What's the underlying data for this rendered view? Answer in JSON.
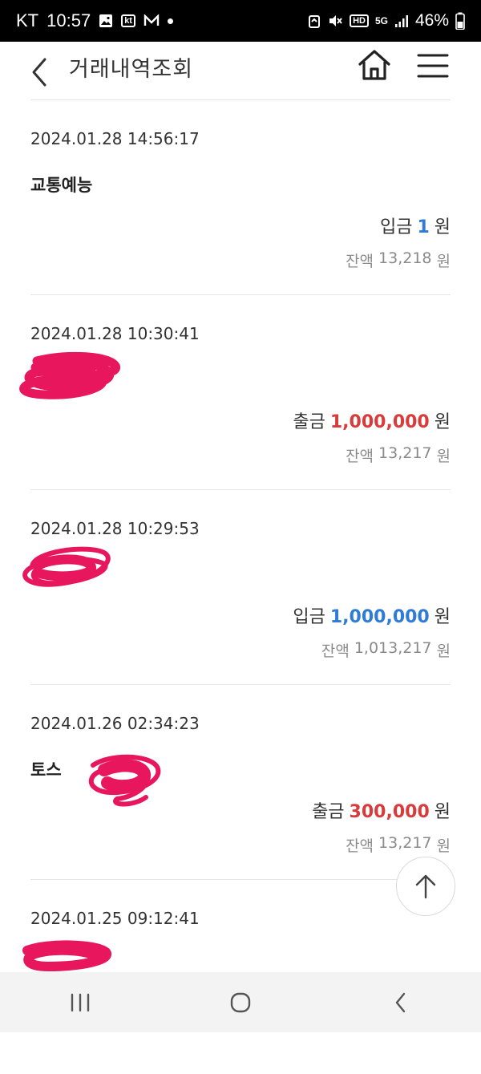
{
  "status_bar": {
    "carrier": "KT",
    "time": "10:57",
    "kt_badge": "kt",
    "network": "5G",
    "hd_badge": "HD",
    "battery": "46%"
  },
  "header": {
    "title": "거래내역조회",
    "icons": [
      "back-icon",
      "home-icon",
      "menu-icon"
    ]
  },
  "transactions": [
    {
      "datetime": "2024.01.28 14:56:17",
      "description": "교통예능",
      "type_label": "입금",
      "type": "deposit",
      "amount": "1",
      "currency": "원",
      "balance_label": "잔액",
      "balance": "13,218",
      "balance_currency": "원"
    },
    {
      "datetime": "2024.01.28 10:30:41",
      "description": "",
      "type_label": "출금",
      "type": "withdraw",
      "amount": "1,000,000",
      "currency": "원",
      "balance_label": "잔액",
      "balance": "13,217",
      "balance_currency": "원"
    },
    {
      "datetime": "2024.01.28 10:29:53",
      "description": "",
      "type_label": "입금",
      "type": "deposit",
      "amount": "1,000,000",
      "currency": "원",
      "balance_label": "잔액",
      "balance": "1,013,217",
      "balance_currency": "원"
    },
    {
      "datetime": "2024.01.26 02:34:23",
      "description": "토스",
      "type_label": "출금",
      "type": "withdraw",
      "amount": "300,000",
      "currency": "원",
      "balance_label": "잔액",
      "balance": "13,217",
      "balance_currency": "원"
    },
    {
      "datetime": "2024.01.25 09:12:41",
      "description": "",
      "type_label": "",
      "type": "",
      "amount": "",
      "currency": "",
      "balance_label": "",
      "balance": "",
      "balance_currency": ""
    }
  ],
  "colors": {
    "deposit": "#2f7bd8",
    "withdraw": "#d93a3a",
    "redaction": "#e8175d",
    "divider": "#e6e6e6"
  },
  "nav": {
    "icons": [
      "recent-apps-icon",
      "home-circle-icon",
      "back-chevron-icon"
    ]
  }
}
